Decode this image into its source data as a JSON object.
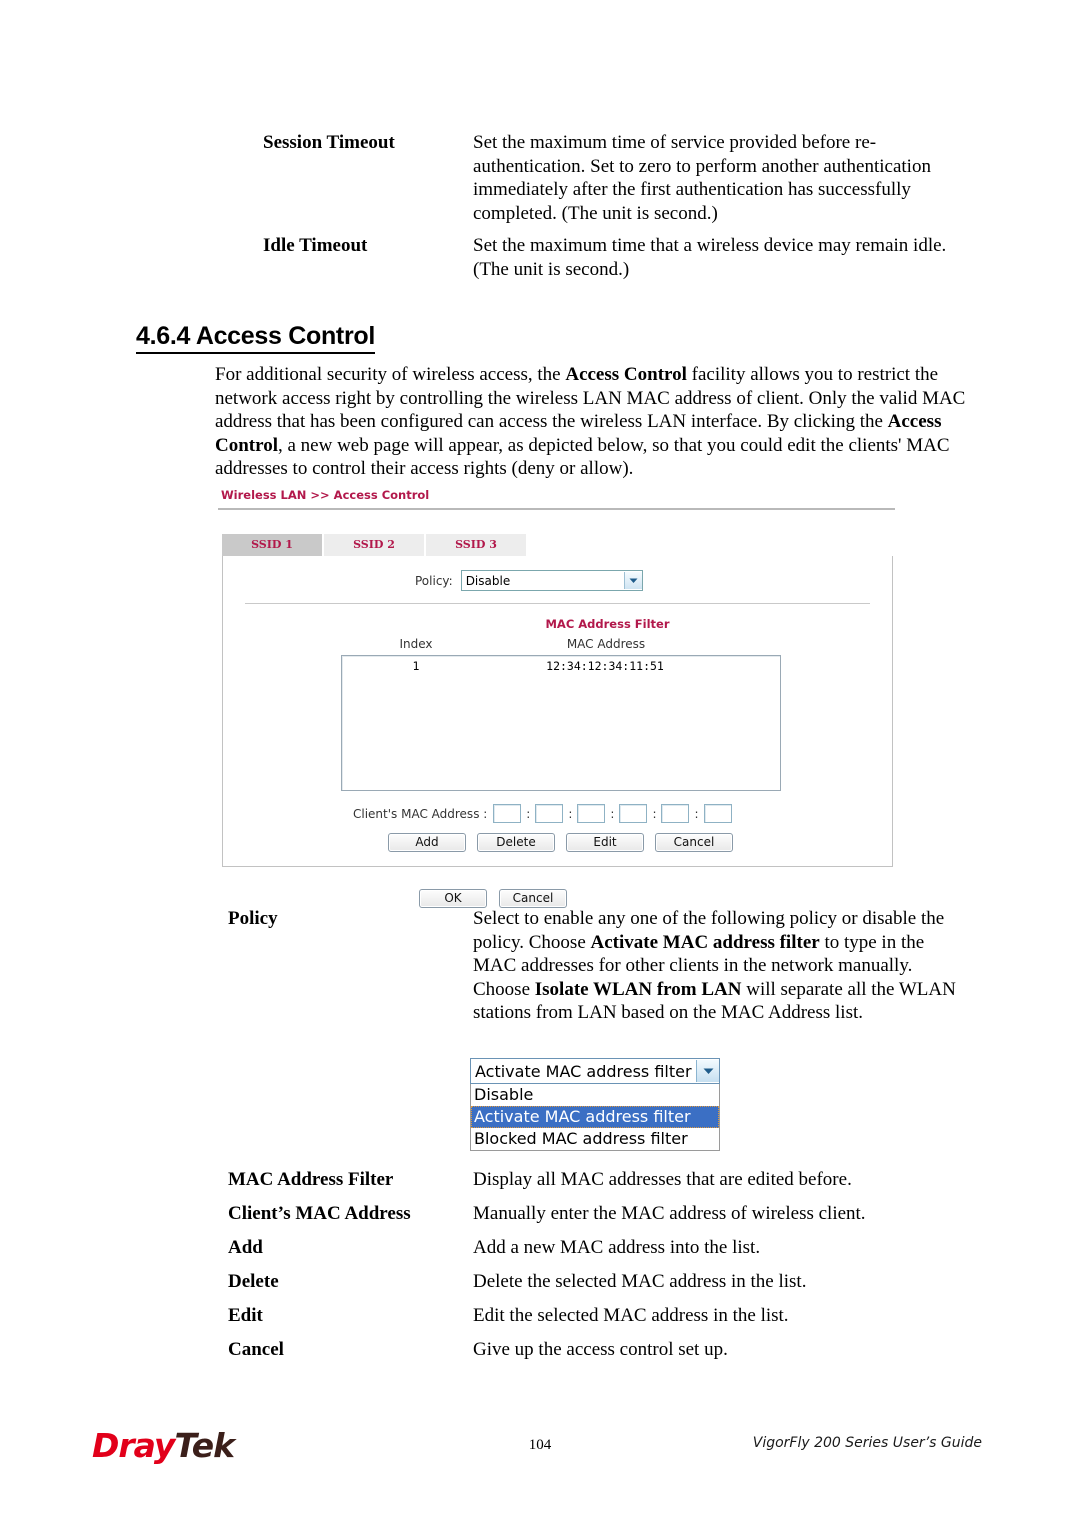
{
  "top_definitions": [
    {
      "term": "Session Timeout",
      "description": "Set the maximum time of service provided before re-authentication. Set to zero to perform another authentication immediately after the first authentication has successfully completed. (The unit is second.)"
    },
    {
      "term": "Idle Timeout",
      "description": "Set the maximum time that a wireless device may remain idle. (The unit is second.)"
    }
  ],
  "section": {
    "number": "4.6.4",
    "title": "Access Control",
    "heading": "4.6.4 Access Control"
  },
  "intro": {
    "parts": [
      {
        "text": "For additional security of wireless access, the ",
        "bold": false
      },
      {
        "text": "Access Control",
        "bold": true
      },
      {
        "text": " facility allows you to restrict the network access right by controlling the wireless LAN MAC address of client. Only the valid MAC address that has been configured can access the wireless LAN interface. By clicking the ",
        "bold": false
      },
      {
        "text": "Access Control",
        "bold": true
      },
      {
        "text": ", a new web page will appear, as depicted below, so that you could edit the clients' MAC addresses to control their access rights (deny or allow).",
        "bold": false
      }
    ]
  },
  "router_ui": {
    "breadcrumb": "Wireless LAN >> Access Control",
    "tabs": [
      {
        "label": "SSID 1",
        "active": true
      },
      {
        "label": "SSID 2",
        "active": false
      },
      {
        "label": "SSID 3",
        "active": false
      }
    ],
    "policy": {
      "label": "Policy:",
      "value": "Disable"
    },
    "mac_filter": {
      "title": "MAC Address Filter",
      "columns": [
        "Index",
        "MAC Address"
      ],
      "rows": [
        {
          "index": "1",
          "mac": "12:34:12:34:11:51"
        }
      ]
    },
    "client_mac": {
      "label": "Client's MAC Address :",
      "separator": ":",
      "octets": [
        "",
        "",
        "",
        "",
        "",
        ""
      ]
    },
    "crud_buttons": [
      "Add",
      "Delete",
      "Edit",
      "Cancel"
    ],
    "form_buttons": [
      "OK",
      "Cancel"
    ]
  },
  "policy_definition": {
    "term": "Policy",
    "parts": [
      {
        "text": "Select to enable any one of the following policy or disable the policy. Choose ",
        "bold": false
      },
      {
        "text": "Activate MAC address filter",
        "bold": true
      },
      {
        "text": " to type in the MAC addresses for other clients in the network manually. Choose ",
        "bold": false
      },
      {
        "text": "Isolate WLAN from LAN",
        "bold": true
      },
      {
        "text": " will separate all the WLAN stations from LAN based on the MAC Address list.",
        "bold": false
      }
    ]
  },
  "policy_dropdown": {
    "selected": "Activate MAC address filter",
    "options": [
      {
        "label": "Disable",
        "selected": false
      },
      {
        "label": "Activate MAC address filter",
        "selected": true
      },
      {
        "label": "Blocked MAC address filter",
        "selected": false
      }
    ]
  },
  "bottom_definitions": [
    {
      "term": "MAC Address Filter",
      "description": "Display all MAC addresses that are edited before."
    },
    {
      "term": "Client’s MAC Address",
      "description": "Manually enter the MAC address of wireless client."
    },
    {
      "term": "Add",
      "description": "Add a new MAC address into the list."
    },
    {
      "term": "Delete",
      "description": "Delete the selected MAC address in the list."
    },
    {
      "term": "Edit",
      "description": "Edit the selected MAC address in the list."
    },
    {
      "term": "Cancel",
      "description": "Give up the access control set up."
    }
  ],
  "footer": {
    "logo_first": "Dray",
    "logo_second": "Tek",
    "page_number": "104",
    "guide": "VigorFly 200 Series User’s Guide"
  },
  "colors": {
    "brand_red": "#e2001a",
    "ui_magenta": "#b2184b",
    "tab_active": "#c9c9c9",
    "tab_inactive": "#ededed",
    "dropdown_highlight": "#3b6fc4"
  }
}
